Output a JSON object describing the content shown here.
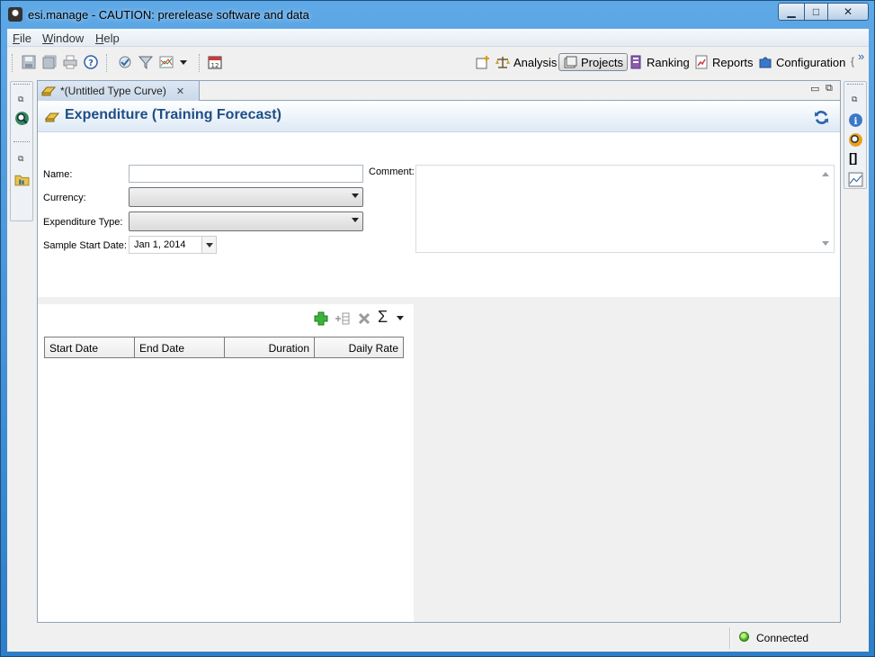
{
  "window": {
    "title": "esi.manage - CAUTION: prerelease software and data",
    "min_glyph": "▁",
    "max_glyph": "□",
    "close_glyph": "✕"
  },
  "menu": {
    "items": [
      "File",
      "Window",
      "Help"
    ]
  },
  "toolbar": {
    "perspectives": [
      {
        "label": "Analysis",
        "icon": "scale-icon"
      },
      {
        "label": "Projects",
        "icon": "projects-icon",
        "active": true
      },
      {
        "label": "Ranking",
        "icon": "ranking-icon"
      },
      {
        "label": "Reports",
        "icon": "reports-icon"
      },
      {
        "label": "Configuration",
        "icon": "puzzle-icon"
      }
    ],
    "overflow": "»"
  },
  "editor": {
    "tab_label": "*(Untitled Type Curve)",
    "form_title": "Expenditure (Training Forecast)",
    "fields": {
      "name_label": "Name:",
      "name_value": "",
      "currency_label": "Currency:",
      "currency_value": "",
      "exp_type_label": "Expenditure Type:",
      "exp_type_value": "",
      "start_date_label": "Sample Start Date:",
      "start_date_value": "Jan 1, 2014",
      "comment_label": "Comment:",
      "comment_value": ""
    },
    "table": {
      "columns": [
        "Start Date",
        "End Date",
        "Duration",
        "Daily Rate"
      ],
      "rows": [],
      "sum_glyph": "Σ"
    }
  },
  "status": {
    "connection": "Connected",
    "connection_color": "#3faa1d"
  },
  "colors": {
    "title_blue": "#1f4e86",
    "frame_blue": "#3d8fd6"
  }
}
